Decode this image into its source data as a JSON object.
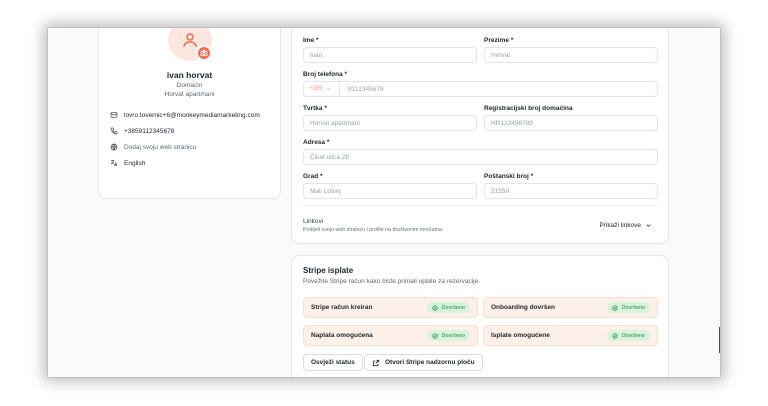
{
  "profile": {
    "name": "ivan horvat",
    "role": "Domaćin",
    "company": "Horvat apartmani",
    "email": "lovro.tovernic+6@monkeymediamarketing.com",
    "phone": "+3859112345678",
    "website_placeholder": "Dodaj svoju web stranicu",
    "language": "English"
  },
  "form": {
    "first_name": {
      "label": "Ime *",
      "placeholder": "Ivan"
    },
    "last_name": {
      "label": "Prezime *",
      "placeholder": "Horvat"
    },
    "phone": {
      "label": "Broj telefona *",
      "country_code": "+385",
      "placeholder": "9112345678"
    },
    "company": {
      "label": "Tvrtka *",
      "placeholder": "Horvat apartmani"
    },
    "host_reg": {
      "label": "Registracijski broj domaćina",
      "placeholder": "HR123456789"
    },
    "address": {
      "label": "Adresa *",
      "placeholder": "Čikat ulica 28"
    },
    "city": {
      "label": "Grad *",
      "placeholder": "Mali Lošinj"
    },
    "postal": {
      "label": "Poštanski broj *",
      "placeholder": "51550"
    },
    "links": {
      "title": "Linkovi",
      "subtitle": "Podijeli svoju web stranicu i profile na društvenim mrežama.",
      "toggle_label": "Prikaži linkove"
    }
  },
  "stripe": {
    "title": "Stripe isplate",
    "subtitle": "Povežite Stripe račun kako biste primali uplate za rezervacije.",
    "items": [
      {
        "label": "Stripe račun kreiran",
        "status": "Dovršeno"
      },
      {
        "label": "Onboarding dovršen",
        "status": "Dovršeno"
      },
      {
        "label": "Naplata omogućena",
        "status": "Dovršeno"
      },
      {
        "label": "Isplate omogućene",
        "status": "Dovršeno"
      }
    ],
    "refresh_label": "Osvježi status",
    "dashboard_label": "Otvori Stripe nadzornu ploču"
  },
  "colors": {
    "accent": "#f26a4b",
    "success_bg": "#d8f3de",
    "success_text": "#1f8a3f",
    "status_box": "#fdf0e8"
  }
}
